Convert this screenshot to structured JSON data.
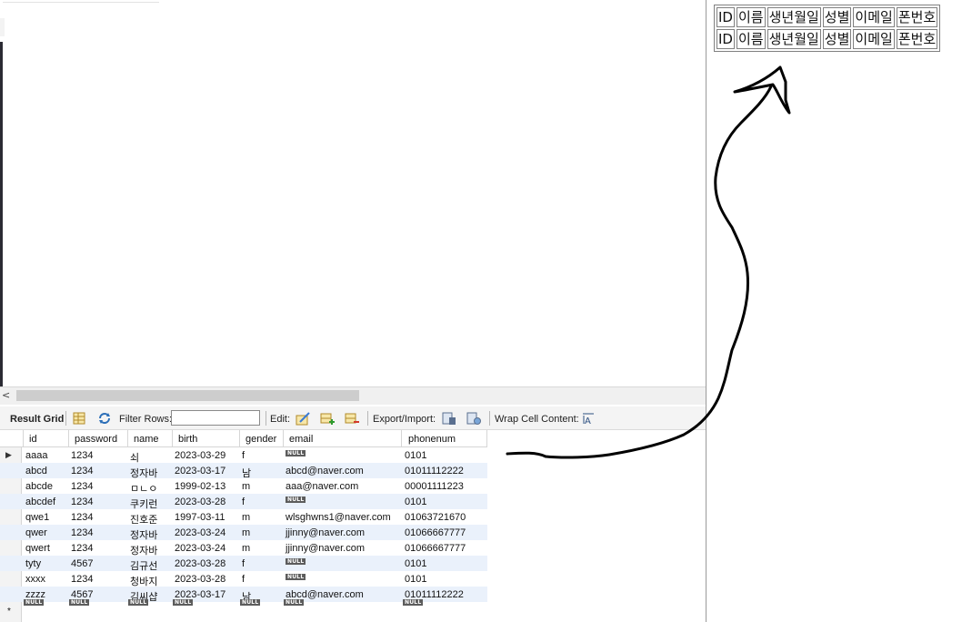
{
  "toolbar": {
    "result_grid": "Result Grid",
    "filter_rows": "Filter Rows:",
    "filter_value": "",
    "edit": "Edit:",
    "export_import": "Export/Import:",
    "wrap_cell": "Wrap Cell Content:",
    "icons": [
      "grid-form-icon",
      "refresh-icon",
      "edit-cell-icon",
      "add-row-icon",
      "delete-row-icon",
      "export-icon",
      "import-icon",
      "wrap-text-icon"
    ]
  },
  "scroll": {
    "left_arrow": "<"
  },
  "grid": {
    "columns": [
      "id",
      "password",
      "name",
      "birth",
      "gender",
      "email",
      "phonenum"
    ],
    "null_label": "NULL",
    "new_row_marker": "*",
    "current_row_marker": "▶",
    "rows": [
      [
        "aaaa",
        "1234",
        "쇠",
        "2023-03-29",
        "f",
        null,
        "0101"
      ],
      [
        "abcd",
        "1234",
        "정자바",
        "2023-03-17",
        "남",
        "abcd@naver.com",
        "01011112222"
      ],
      [
        "abcde",
        "1234",
        "ㅁㄴㅇ",
        "1999-02-13",
        "m",
        "aaa@naver.com",
        "00001111223"
      ],
      [
        "abcdef",
        "1234",
        "쿠키런",
        "2023-03-28",
        "f",
        null,
        "0101"
      ],
      [
        "qwe1",
        "1234",
        "진호준",
        "1997-03-11",
        "m",
        "wlsghwns1@naver.com",
        "01063721670"
      ],
      [
        "qwer",
        "1234",
        "정자바",
        "2023-03-24",
        "m",
        "jjinny@naver.com",
        "01066667777"
      ],
      [
        "qwert",
        "1234",
        "정자바",
        "2023-03-24",
        "m",
        "jjinny@naver.com",
        "01066667777"
      ],
      [
        "tyty",
        "4567",
        "김규선",
        "2023-03-28",
        "f",
        null,
        "0101"
      ],
      [
        "xxxx",
        "1234",
        "청바지",
        "2023-03-28",
        "f",
        null,
        "0101"
      ],
      [
        "zzzz",
        "4567",
        "김씨샵",
        "2023-03-17",
        "남",
        "abcd@naver.com",
        "01011112222"
      ]
    ]
  },
  "preview": {
    "header_row": [
      "ID",
      "이름",
      "생년월일",
      "성별",
      "이메일",
      "폰번호"
    ],
    "row2": [
      "ID",
      "이름",
      "생년월일",
      "성별",
      "이메일",
      "폰번호"
    ]
  },
  "colors": {
    "alt_row": "#eaf1fb",
    "null_badge": "#5c5c5c",
    "arrow": "#000000"
  }
}
